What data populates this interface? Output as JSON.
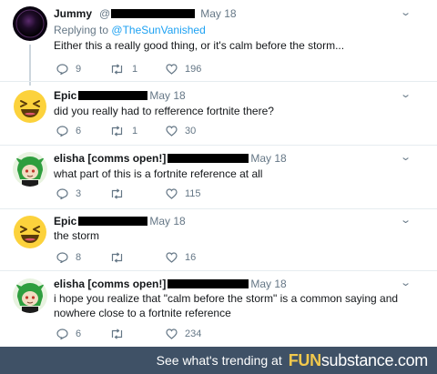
{
  "tweets": [
    {
      "name": "Jummy",
      "handle_prefix": "@",
      "time": "May 18",
      "replying_prefix": "Replying to",
      "replying_handle": "@TheSunVanished",
      "text": "Either this a really good thing, or it's calm before the storm...",
      "replies": "9",
      "retweets": "1",
      "likes": "196",
      "avatar": "dark-sphere-avatar"
    },
    {
      "name": "Epic",
      "time": "May 18",
      "text": "did you really had to refference fortnite there?",
      "replies": "6",
      "retweets": "1",
      "likes": "30",
      "avatar": "laughing-emoji-avatar"
    },
    {
      "name": "elisha [comms open!]",
      "time": "May 18",
      "text": "what part of this is a fortnite reference at all",
      "replies": "3",
      "retweets": "",
      "likes": "115",
      "avatar": "green-character-avatar"
    },
    {
      "name": "Epic",
      "time": "May 18",
      "text": "the storm",
      "replies": "8",
      "retweets": "",
      "likes": "16",
      "avatar": "laughing-emoji-avatar"
    },
    {
      "name": "elisha [comms open!]",
      "time": "May 18",
      "text": "i hope you realize that \"calm before the storm\" is a common saying and nowhere close to a fortnite reference",
      "replies": "6",
      "retweets": "",
      "likes": "234",
      "avatar": "green-character-avatar"
    }
  ],
  "banner": {
    "text": "See what's trending at",
    "logo_fun": "FUN",
    "logo_sub": "substance",
    "logo_com": ".com"
  },
  "colors": {
    "link": "#1da1f2",
    "muted": "#657786",
    "banner_bg": "#3f5166",
    "logo_accent": "#f2c94c"
  }
}
